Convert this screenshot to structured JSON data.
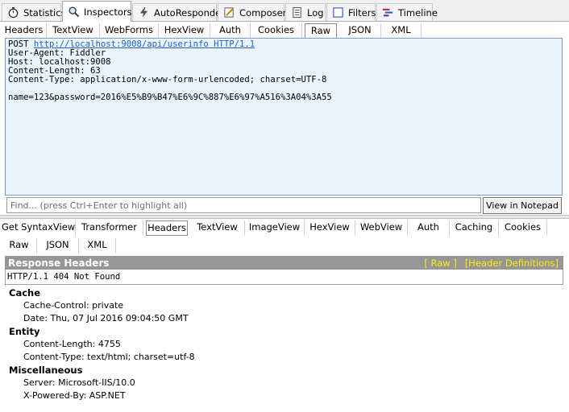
{
  "top_tabs": [
    {
      "label": "Statistics",
      "icon": "stopwatch-icon"
    },
    {
      "label": "Inspectors",
      "icon": "magnifier-icon"
    },
    {
      "label": "AutoResponder",
      "icon": "lightning-icon"
    },
    {
      "label": "Composer",
      "icon": "pencil-icon"
    },
    {
      "label": "Log",
      "icon": "log-icon"
    },
    {
      "label": "Filters",
      "icon": "checkbox-icon"
    },
    {
      "label": "Timeline",
      "icon": "timeline-icon"
    }
  ],
  "request_tabs": [
    "Headers",
    "TextView",
    "WebForms",
    "HexView",
    "Auth",
    "Cookies",
    "Raw",
    "JSON",
    "XML"
  ],
  "request": {
    "method": "POST",
    "url": "http://localhost:9008/api/userinfo",
    "protocol": "HTTP/1.1",
    "headers_text": "User-Agent: Fiddler\nHost: localhost:9008\nContent-Length: 63\nContent-Type: application/x-www-form-urlencoded; charset=UTF-8",
    "body_text": "name=123&password=2016%E5%B9%B47%E6%9C%887%E6%97%A516%3A04%3A55"
  },
  "find": {
    "placeholder": "Find... (press Ctrl+Enter to highlight all)"
  },
  "view_notepad_label": "View in Notepad",
  "response_tabs_row1": [
    "Get SyntaxView",
    "Transformer",
    "Headers",
    "TextView",
    "ImageView",
    "HexView",
    "WebView",
    "Auth",
    "Caching",
    "Cookies"
  ],
  "response_tabs_row2": [
    "Raw",
    "JSON",
    "XML"
  ],
  "response": {
    "title": "Response Headers",
    "raw_link": "[ Raw ]",
    "defs_link": "[Header Definitions]",
    "status_line": "HTTP/1.1 404 Not Found",
    "groups": [
      {
        "name": "Cache",
        "items": [
          "Cache-Control: private",
          "Date: Thu, 07 Jul 2016 09:04:50 GMT"
        ]
      },
      {
        "name": "Entity",
        "items": [
          "Content-Length: 4755",
          "Content-Type: text/html; charset=utf-8"
        ]
      },
      {
        "name": "Miscellaneous",
        "items": [
          "Server: Microsoft-IIS/10.0",
          "X-Powered-By: ASP.NET"
        ]
      }
    ]
  },
  "colors": {
    "request_bg": "#eaf4fc",
    "header_bar": "#969696",
    "link_yellow": "#ffee00"
  }
}
